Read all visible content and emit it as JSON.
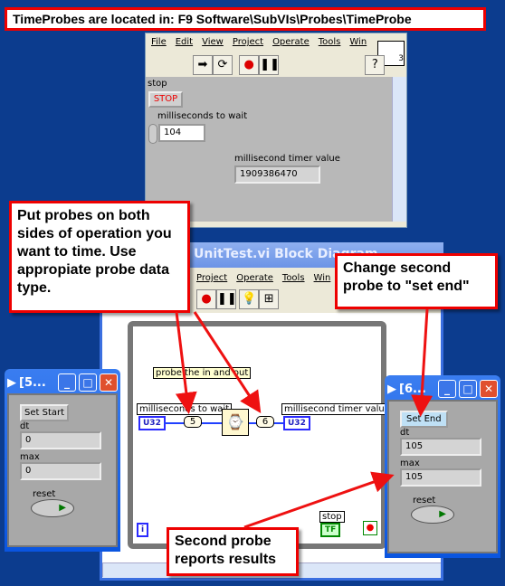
{
  "banner": "TimeProbes are located in: F9 Software\\SubVIs\\Probes\\TimeProbe",
  "front_panel": {
    "menu": [
      "File",
      "Edit",
      "View",
      "Project",
      "Operate",
      "Tools",
      "Win"
    ],
    "vi_icon_number": "3",
    "stop_label": "stop",
    "stop_button": "STOP",
    "ms_wait_label": "milliseconds to wait",
    "ms_wait_value": "104",
    "timer_label": "millisecond timer value",
    "timer_value": "1909386470"
  },
  "block_diagram": {
    "title": "UnitTest.vi Block Diagram",
    "menu": [
      "Project",
      "Operate",
      "Tools",
      "Win"
    ],
    "comment": "probe the in and out",
    "ms_wait_label": "milliseconds to wait",
    "ms_wait_type": "U32",
    "probe_in": "5",
    "probe_out": "6",
    "timer_label": "millisecond timer value",
    "timer_type": "U32",
    "stop_label": "stop",
    "stop_type": "TF",
    "iteration": "i"
  },
  "probe_start": {
    "title": "[5...",
    "button": "Set Start",
    "dt_label": "dt",
    "dt": "0",
    "max_label": "max",
    "max": "0",
    "reset_label": "reset"
  },
  "probe_end": {
    "title": "[6...",
    "button": "Set End",
    "dt_label": "dt",
    "dt": "105",
    "max_label": "max",
    "max": "105",
    "reset_label": "reset"
  },
  "callouts": {
    "probes": "Put probes on both sides of operation you want to time. Use appropiate probe data type.",
    "set_end": "Change second probe to \"set end\"",
    "results": "Second probe reports results"
  },
  "colors": {
    "desktop": "#0c3c8e",
    "callout_border": "#ee0000",
    "arrow": "#ee1111",
    "wire": "#2040ff"
  }
}
